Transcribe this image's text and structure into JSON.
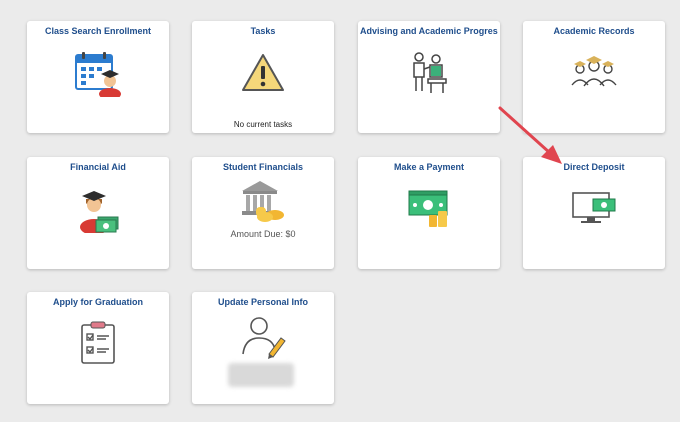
{
  "tiles": {
    "class_search": {
      "title": "Class Search Enrollment",
      "icon": "calendar-student-icon"
    },
    "tasks": {
      "title": "Tasks",
      "subtitle": "No current tasks",
      "icon": "warning-icon"
    },
    "advising": {
      "title": "Advising and Academic Progress",
      "icon": "advisor-meeting-icon"
    },
    "academic_records": {
      "title": "Academic Records",
      "icon": "graduates-group-icon"
    },
    "financial_aid": {
      "title": "Financial Aid",
      "icon": "graduate-money-icon"
    },
    "student_financials": {
      "title": "Student Financials",
      "subtitle": "Amount Due: $0",
      "icon": "bank-coins-icon"
    },
    "make_payment": {
      "title": "Make a Payment",
      "icon": "cash-coins-icon"
    },
    "direct_deposit": {
      "title": "Direct Deposit",
      "icon": "monitor-cash-icon"
    },
    "apply_graduation": {
      "title": "Apply for Graduation",
      "icon": "checklist-clipboard-icon"
    },
    "update_personal": {
      "title": "Update Personal Info",
      "icon": "person-edit-icon"
    }
  },
  "annotation": {
    "arrow_color": "#e0454f"
  },
  "colors": {
    "title": "#1f4e8c",
    "background": "#ebebeb",
    "tile": "#ffffff"
  }
}
